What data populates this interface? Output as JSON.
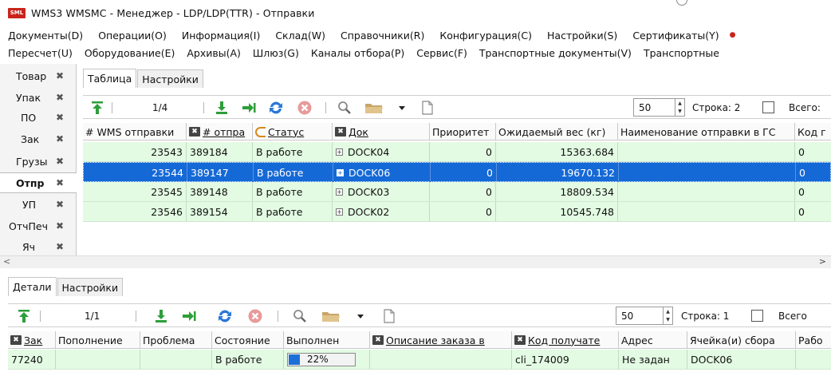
{
  "window": {
    "logo_text": "SML",
    "title": "WMS3 WMSMC - Менеджер - LDP/LDP(TTR) - Отправки"
  },
  "menubar1": [
    "Документы(D)",
    "Операции(O)",
    "Информация(I)",
    "Склад(W)",
    "Справочники(R)",
    "Конфигурация(C)",
    "Настройки(S)",
    "Сертификаты(Y)"
  ],
  "menubar2": [
    "Пересчет(U)",
    "Оборудование(E)",
    "Архивы(A)",
    "Шлюз(G)",
    "Каналы отбора(P)",
    "Сервис(F)",
    "Транспортные документы(V)",
    "Транспортные"
  ],
  "left_tabs": [
    {
      "label": "Товар",
      "active": false
    },
    {
      "label": "Упак",
      "active": false
    },
    {
      "label": "ПО",
      "active": false
    },
    {
      "label": "Зак",
      "active": false
    },
    {
      "label": "Грузы",
      "active": false
    },
    {
      "label": "Отпр",
      "active": true
    },
    {
      "label": "УП",
      "active": false
    },
    {
      "label": "ОтчПеч",
      "active": false
    },
    {
      "label": "Яч",
      "active": false
    }
  ],
  "upper": {
    "tabs": [
      "Таблица",
      "Настройки"
    ],
    "pager": "1/4",
    "page_size": "50",
    "row_label": "Строка: 2",
    "total_label": "Всего:",
    "columns": [
      "# WMS отправки",
      "# отпра",
      "Статус",
      "Док",
      "Приоритет",
      "Ожидаемый вес (кг)",
      "Наименование отправки в ГС",
      "Код г"
    ],
    "rows": [
      {
        "wms": "23543",
        "num": "389184",
        "status": "В работе",
        "dock": "DOCK04",
        "priority": "0",
        "weight": "15363.684",
        "name": "",
        "code": "0",
        "selected": false
      },
      {
        "wms": "23544",
        "num": "389147",
        "status": "В работе",
        "dock": "DOCK06",
        "priority": "0",
        "weight": "19670.132",
        "name": "",
        "code": "0",
        "selected": true
      },
      {
        "wms": "23545",
        "num": "389148",
        "status": "В работе",
        "dock": "DOCK03",
        "priority": "0",
        "weight": "18809.534",
        "name": "",
        "code": "0",
        "selected": false
      },
      {
        "wms": "23546",
        "num": "389154",
        "status": "В работе",
        "dock": "DOCK02",
        "priority": "0",
        "weight": "10545.748",
        "name": "",
        "code": "0",
        "selected": false
      }
    ]
  },
  "lower": {
    "tabs": [
      "Детали",
      "Настройки"
    ],
    "pager": "1/1",
    "page_size": "50",
    "row_label": "Строка: 1",
    "total_label": "Всего",
    "columns": [
      "Зак",
      "Пополнение",
      "Проблема",
      "Состояние",
      "Выполнен",
      "Описание заказа в",
      "Код получате",
      "Адрес",
      "Ячейка(и) сбора",
      "Рабо"
    ],
    "rows": [
      {
        "order": "77240",
        "refill": "",
        "problem": "",
        "state": "В работе",
        "done_text": "22%",
        "done_pct": 22,
        "desc": "",
        "recipient": "cli_174009",
        "address": "Не задан",
        "cells": "DOCK06",
        "work": ""
      }
    ]
  },
  "colors": {
    "row_green": "#e3fbe3",
    "selection_blue": "#1569d6",
    "accent_green": "#2e9e3a",
    "refresh_blue": "#2a78d6",
    "stop_red": "#d9534f"
  },
  "icons": [
    "move-top-icon",
    "download-icon",
    "import-icon",
    "refresh-icon",
    "stop-icon",
    "search-icon",
    "folder-icon",
    "dropdown-arrow-icon",
    "new-document-icon",
    "close-x-icon",
    "expand-plus-icon"
  ]
}
